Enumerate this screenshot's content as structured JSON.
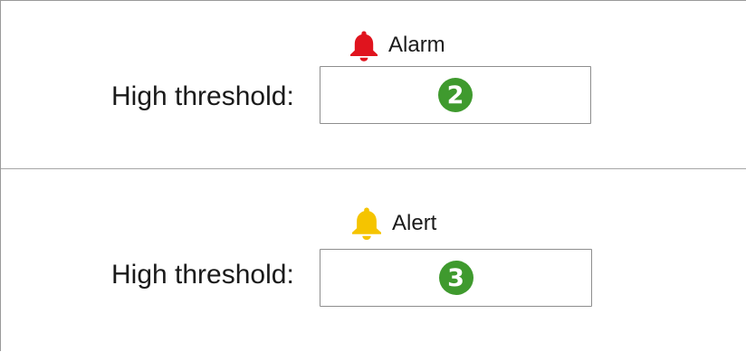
{
  "alarm": {
    "heading": "Alarm",
    "bell_color": "#e0141e",
    "label": "High threshold:",
    "step": "2",
    "icon": "bell-icon"
  },
  "alert": {
    "heading": "Alert",
    "bell_color": "#f5c400",
    "label": "High threshold:",
    "step": "3",
    "icon": "bell-icon"
  },
  "badge_color": "#3f9a2e"
}
